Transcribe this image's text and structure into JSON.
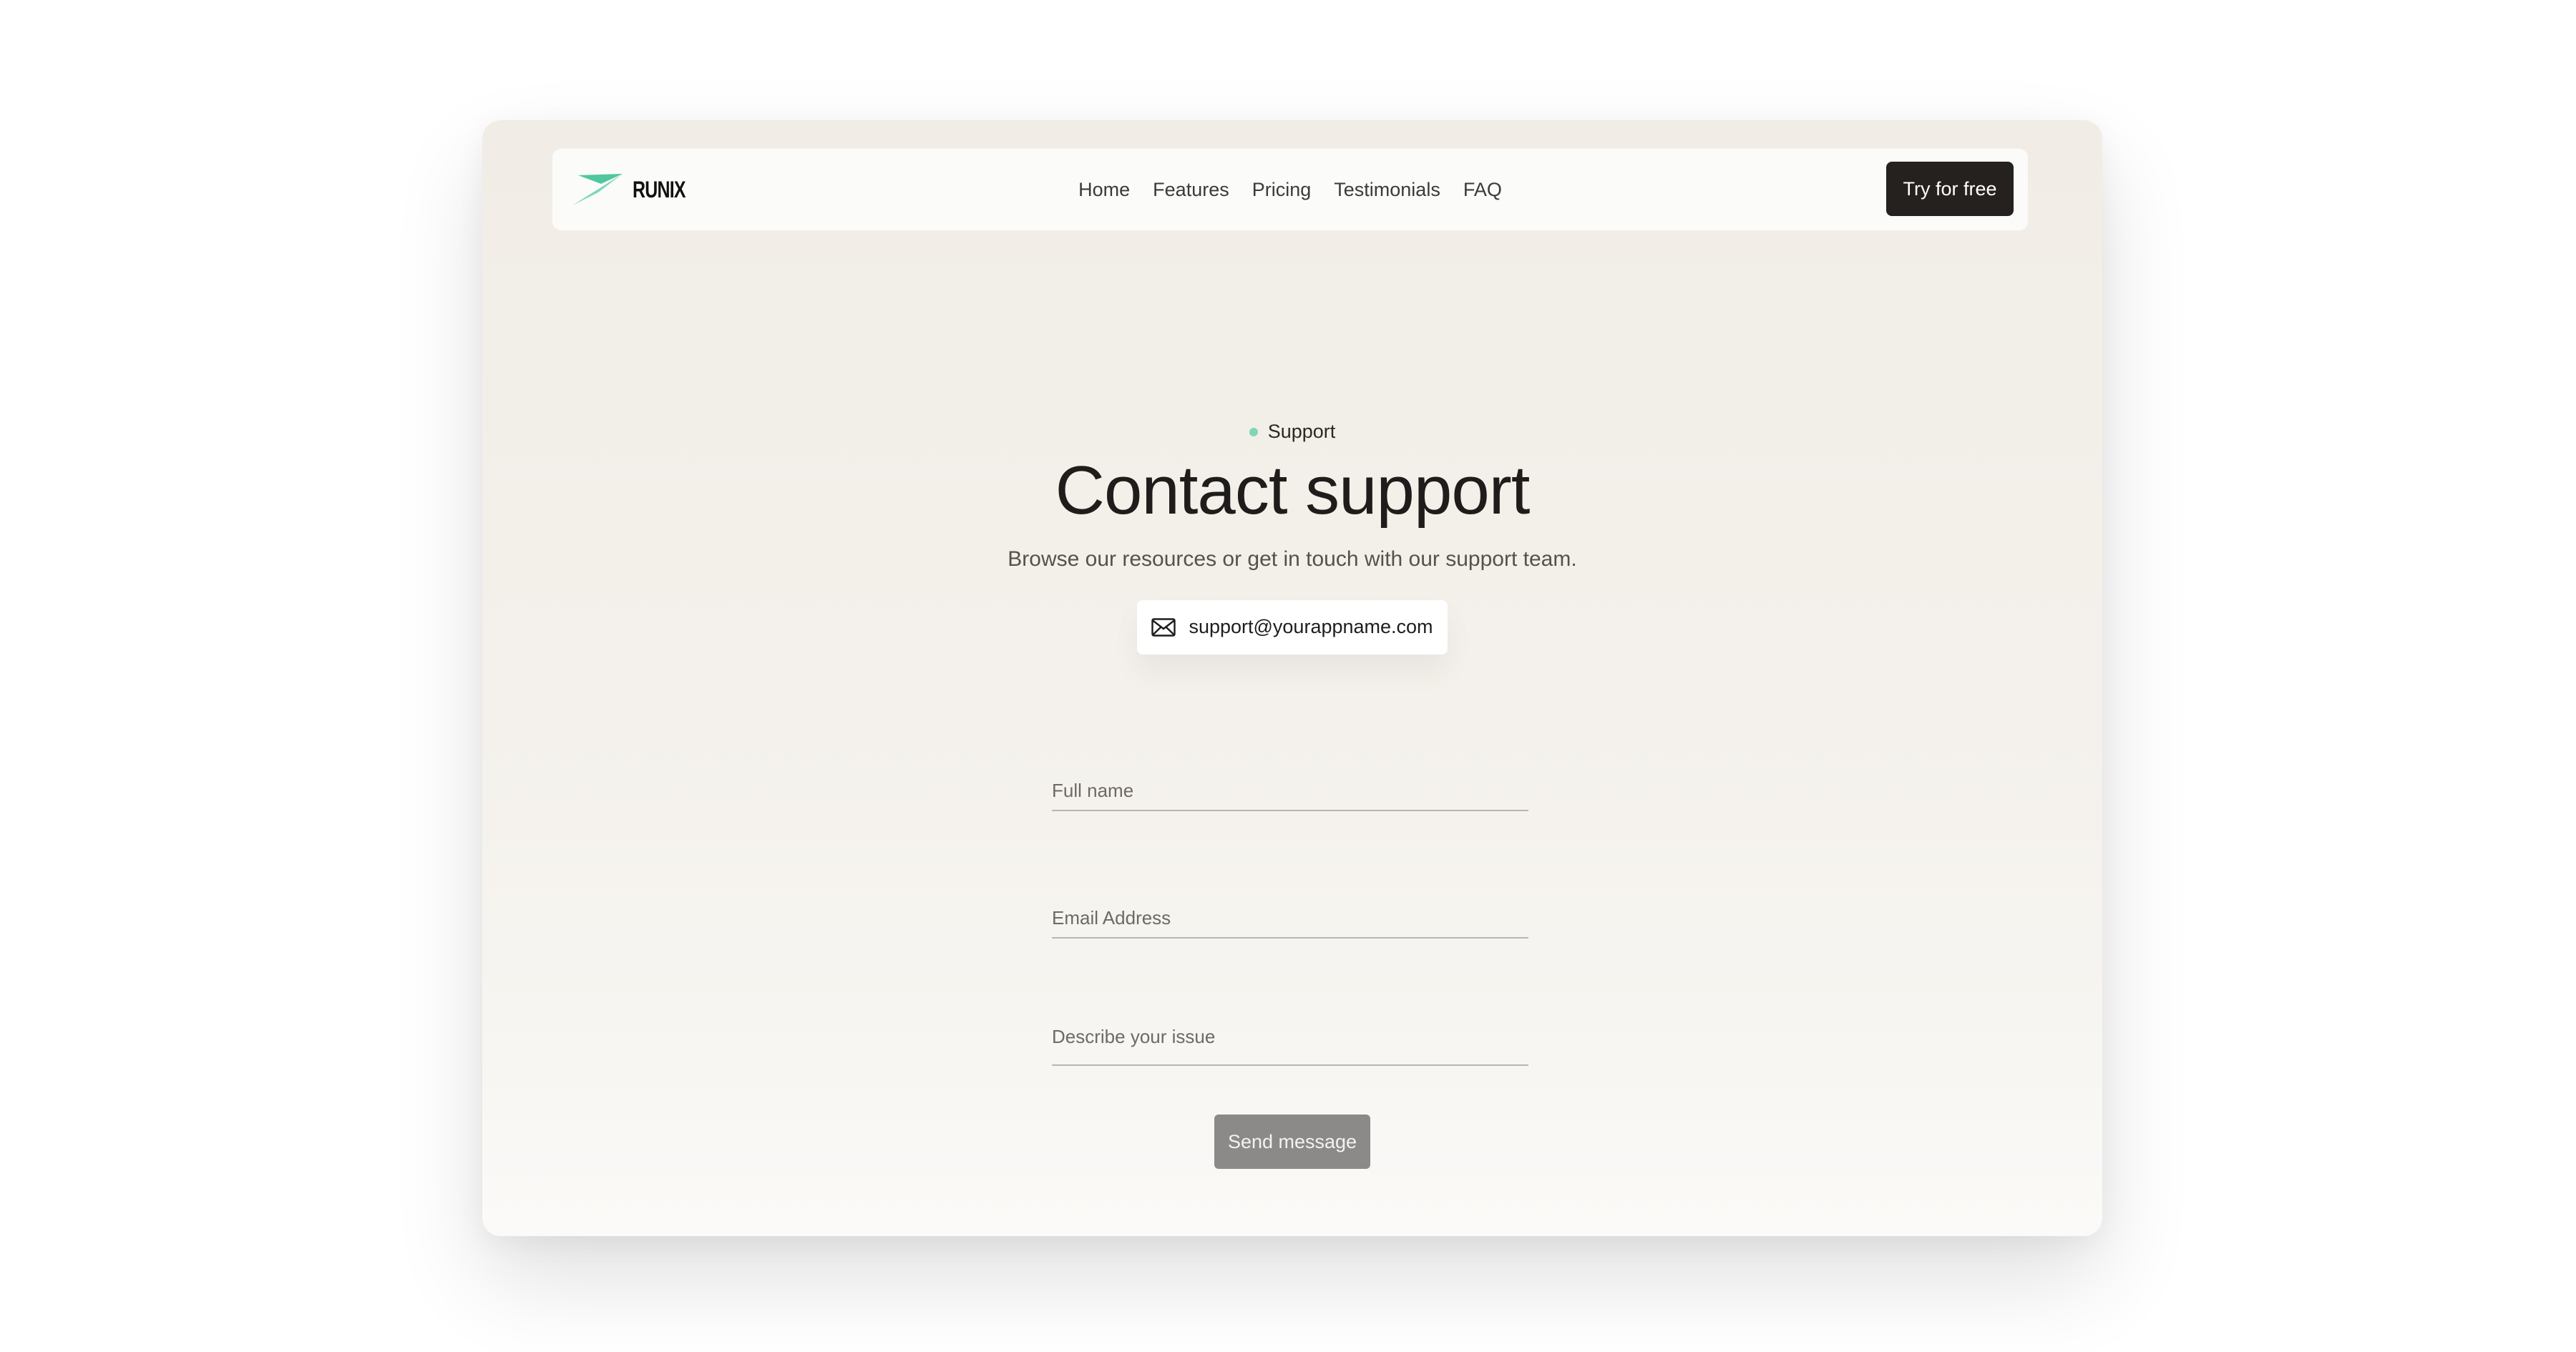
{
  "navbar": {
    "brand": "RUNIX",
    "links": [
      {
        "label": "Home"
      },
      {
        "label": "Features"
      },
      {
        "label": "Pricing"
      },
      {
        "label": "Testimonials"
      },
      {
        "label": "FAQ"
      }
    ],
    "cta_label": "Try for free"
  },
  "hero": {
    "eyebrow": "Support",
    "title": "Contact support",
    "subtitle": "Browse our resources or get in touch with our support team.",
    "email": "support@yourappname.com",
    "email_icon": "mail-icon"
  },
  "form": {
    "full_name": {
      "placeholder": "Full name",
      "value": ""
    },
    "email": {
      "placeholder": "Email Address",
      "value": ""
    },
    "issue": {
      "placeholder": "Describe your issue",
      "value": ""
    },
    "submit_label": "Send message"
  },
  "colors": {
    "accent": "#7fd6b9",
    "dark_button": "#24211f",
    "disabled_button": "#8c8a88",
    "background": "#f3efe9"
  }
}
